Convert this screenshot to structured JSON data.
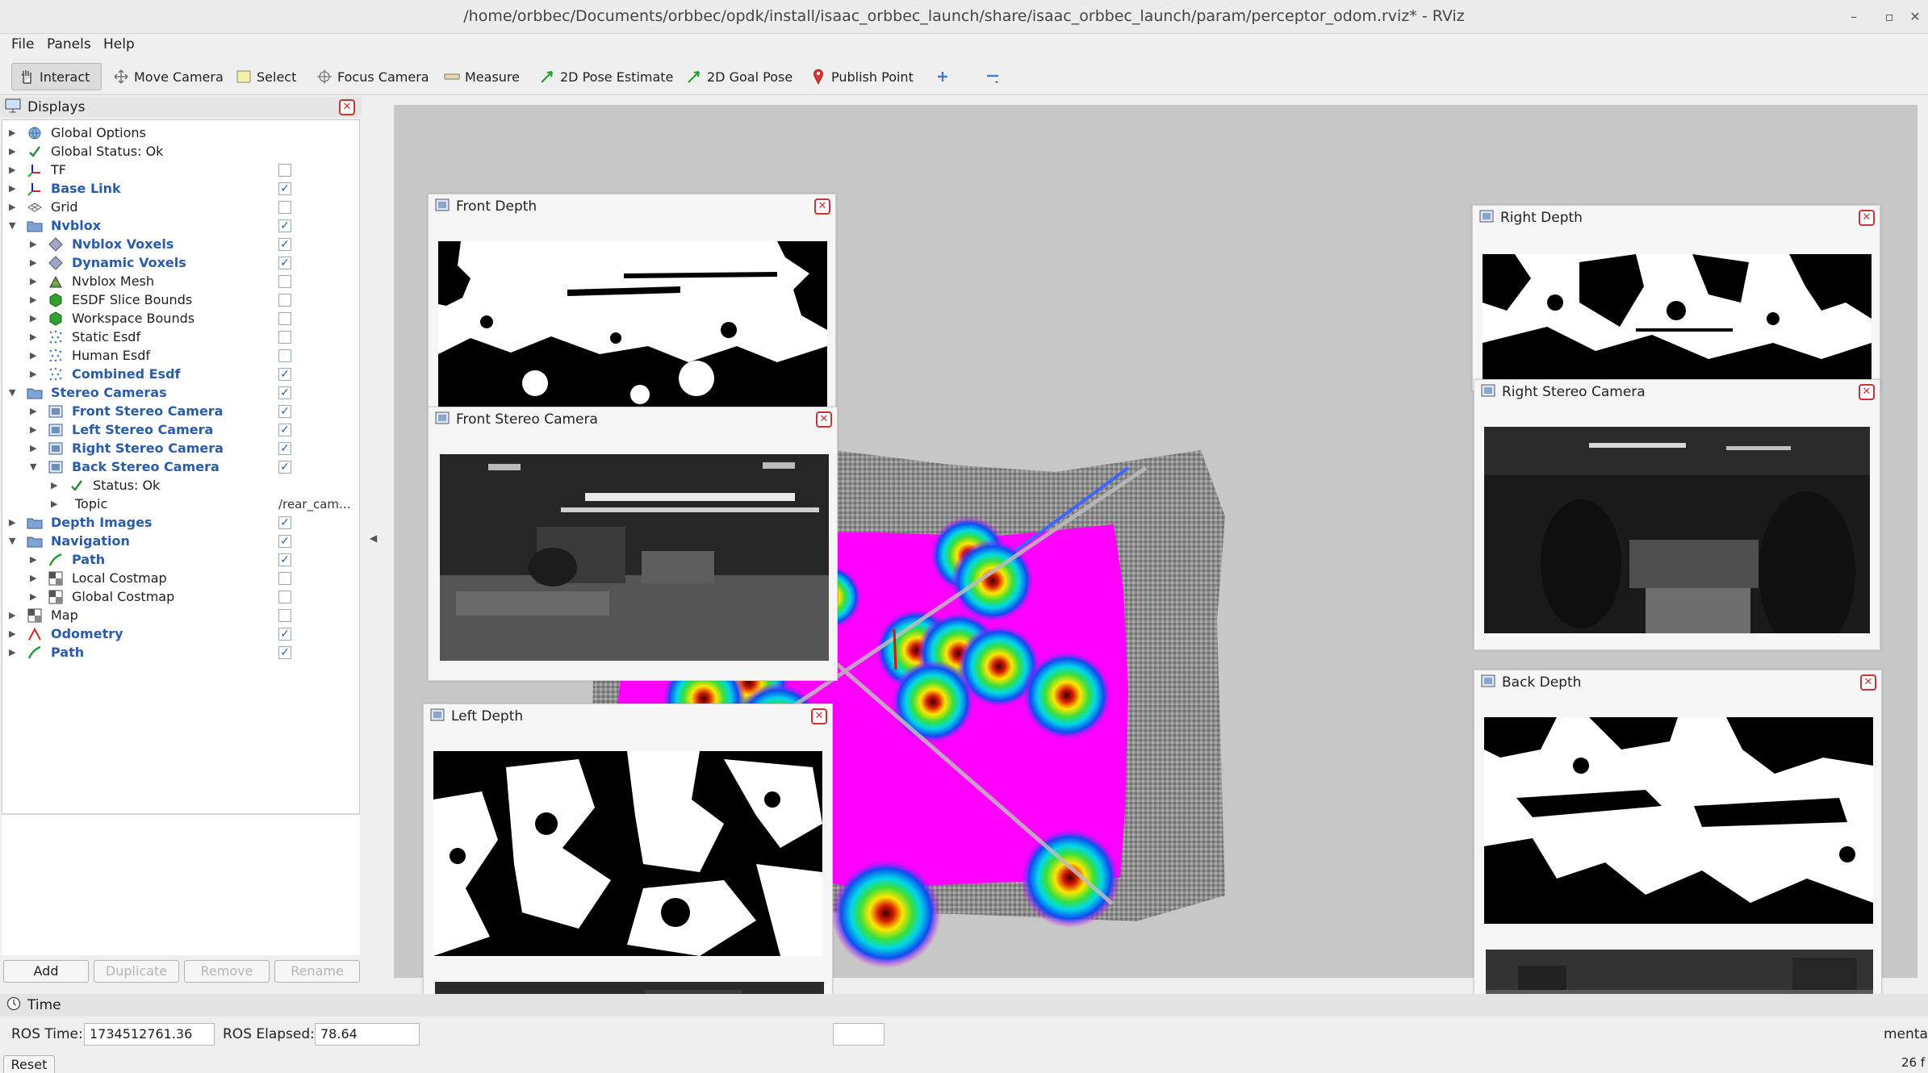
{
  "window": {
    "title": "/home/orbbec/Documents/orbbec/opdk/install/isaac_orbbec_launch/share/isaac_orbbec_launch/param/perceptor_odom.rviz* - RViz"
  },
  "menu": {
    "file": "File",
    "panels": "Panels",
    "help": "Help"
  },
  "toolbar": {
    "interact": "Interact",
    "move_camera": "Move Camera",
    "select": "Select",
    "focus_camera": "Focus Camera",
    "measure": "Measure",
    "pose_estimate": "2D Pose Estimate",
    "goal_pose": "2D Goal Pose",
    "publish_point": "Publish Point"
  },
  "displays": {
    "title": "Displays",
    "items": [
      {
        "label": "Global Options",
        "bold": false,
        "depth": 0,
        "expanded": false,
        "checkbox": null,
        "icon": "globe-icon"
      },
      {
        "label": "Global Status: Ok",
        "bold": false,
        "depth": 0,
        "expanded": false,
        "checkbox": null,
        "icon": "check-icon"
      },
      {
        "label": "TF",
        "bold": false,
        "depth": 0,
        "expanded": false,
        "checkbox": false,
        "icon": "axes-icon"
      },
      {
        "label": "Base Link",
        "bold": true,
        "depth": 0,
        "expanded": false,
        "checkbox": true,
        "icon": "axes-icon"
      },
      {
        "label": "Grid",
        "bold": false,
        "depth": 0,
        "expanded": false,
        "checkbox": false,
        "icon": "grid-icon"
      },
      {
        "label": "Nvblox",
        "bold": true,
        "depth": 0,
        "expanded": true,
        "checkbox": true,
        "icon": "folder-icon"
      },
      {
        "label": "Nvblox Voxels",
        "bold": true,
        "depth": 1,
        "expanded": false,
        "checkbox": true,
        "icon": "diamond-icon"
      },
      {
        "label": "Dynamic Voxels",
        "bold": true,
        "depth": 1,
        "expanded": false,
        "checkbox": true,
        "icon": "diamond-icon"
      },
      {
        "label": "Nvblox Mesh",
        "bold": false,
        "depth": 1,
        "expanded": false,
        "checkbox": false,
        "icon": "mesh-icon"
      },
      {
        "label": "ESDF Slice Bounds",
        "bold": false,
        "depth": 1,
        "expanded": false,
        "checkbox": false,
        "icon": "cube-icon"
      },
      {
        "label": "Workspace Bounds",
        "bold": false,
        "depth": 1,
        "expanded": false,
        "checkbox": false,
        "icon": "cube-icon"
      },
      {
        "label": "Static Esdf",
        "bold": false,
        "depth": 1,
        "expanded": false,
        "checkbox": false,
        "icon": "points-icon"
      },
      {
        "label": "Human Esdf",
        "bold": false,
        "depth": 1,
        "expanded": false,
        "checkbox": false,
        "icon": "points-icon"
      },
      {
        "label": "Combined Esdf",
        "bold": true,
        "depth": 1,
        "expanded": false,
        "checkbox": true,
        "icon": "points-icon"
      },
      {
        "label": "Stereo Cameras",
        "bold": true,
        "depth": 0,
        "expanded": true,
        "checkbox": true,
        "icon": "folder-icon"
      },
      {
        "label": "Front Stereo Camera",
        "bold": true,
        "depth": 1,
        "expanded": false,
        "checkbox": true,
        "icon": "image-icon"
      },
      {
        "label": "Left Stereo Camera",
        "bold": true,
        "depth": 1,
        "expanded": false,
        "checkbox": true,
        "icon": "image-icon"
      },
      {
        "label": "Right Stereo Camera",
        "bold": true,
        "depth": 1,
        "expanded": false,
        "checkbox": true,
        "icon": "image-icon"
      },
      {
        "label": "Back Stereo Camera",
        "bold": true,
        "depth": 1,
        "expanded": true,
        "checkbox": true,
        "icon": "image-icon"
      },
      {
        "label": "Status: Ok",
        "bold": false,
        "depth": 2,
        "expanded": false,
        "checkbox": null,
        "icon": "check-icon"
      },
      {
        "label": "Topic",
        "bold": false,
        "depth": 2,
        "expanded": false,
        "checkbox": null,
        "icon": "",
        "value": "/rear_cam..."
      },
      {
        "label": "Depth Images",
        "bold": true,
        "depth": 0,
        "expanded": false,
        "checkbox": true,
        "icon": "folder-icon"
      },
      {
        "label": "Navigation",
        "bold": true,
        "depth": 0,
        "expanded": true,
        "checkbox": true,
        "icon": "folder-icon"
      },
      {
        "label": "Path",
        "bold": true,
        "depth": 1,
        "expanded": false,
        "checkbox": true,
        "icon": "path-icon"
      },
      {
        "label": "Local Costmap",
        "bold": false,
        "depth": 1,
        "expanded": false,
        "checkbox": false,
        "icon": "map-icon"
      },
      {
        "label": "Global Costmap",
        "bold": false,
        "depth": 1,
        "expanded": false,
        "checkbox": false,
        "icon": "map-icon"
      },
      {
        "label": "Map",
        "bold": false,
        "depth": 0,
        "expanded": false,
        "checkbox": false,
        "icon": "map-icon"
      },
      {
        "label": "Odometry",
        "bold": true,
        "depth": 0,
        "expanded": false,
        "checkbox": true,
        "icon": "odometry-icon"
      },
      {
        "label": "Path",
        "bold": true,
        "depth": 0,
        "expanded": false,
        "checkbox": true,
        "icon": "path-icon"
      }
    ],
    "buttons": {
      "add": "Add",
      "duplicate": "Duplicate",
      "remove": "Remove",
      "rename": "Rename"
    }
  },
  "panels": {
    "front_depth": "Front Depth",
    "front_stereo": "Front Stereo Camera",
    "left_depth": "Left Depth",
    "right_depth": "Right Depth",
    "right_stereo": "Right Stereo Camera",
    "back_depth": "Back Depth"
  },
  "time": {
    "title": "Time",
    "ros_time_label": "ROS Time:",
    "ros_time": "1734512761.36",
    "ros_elapsed_label": "ROS Elapsed:",
    "ros_elapsed": "78.64",
    "reset": "Reset",
    "right_fragment": "mental",
    "corner_fragment": "26 f"
  },
  "colors": {
    "bold_label": "#2a5ca8",
    "esdf_free": "#ff00ff",
    "view_background": "#c7c7c7"
  }
}
